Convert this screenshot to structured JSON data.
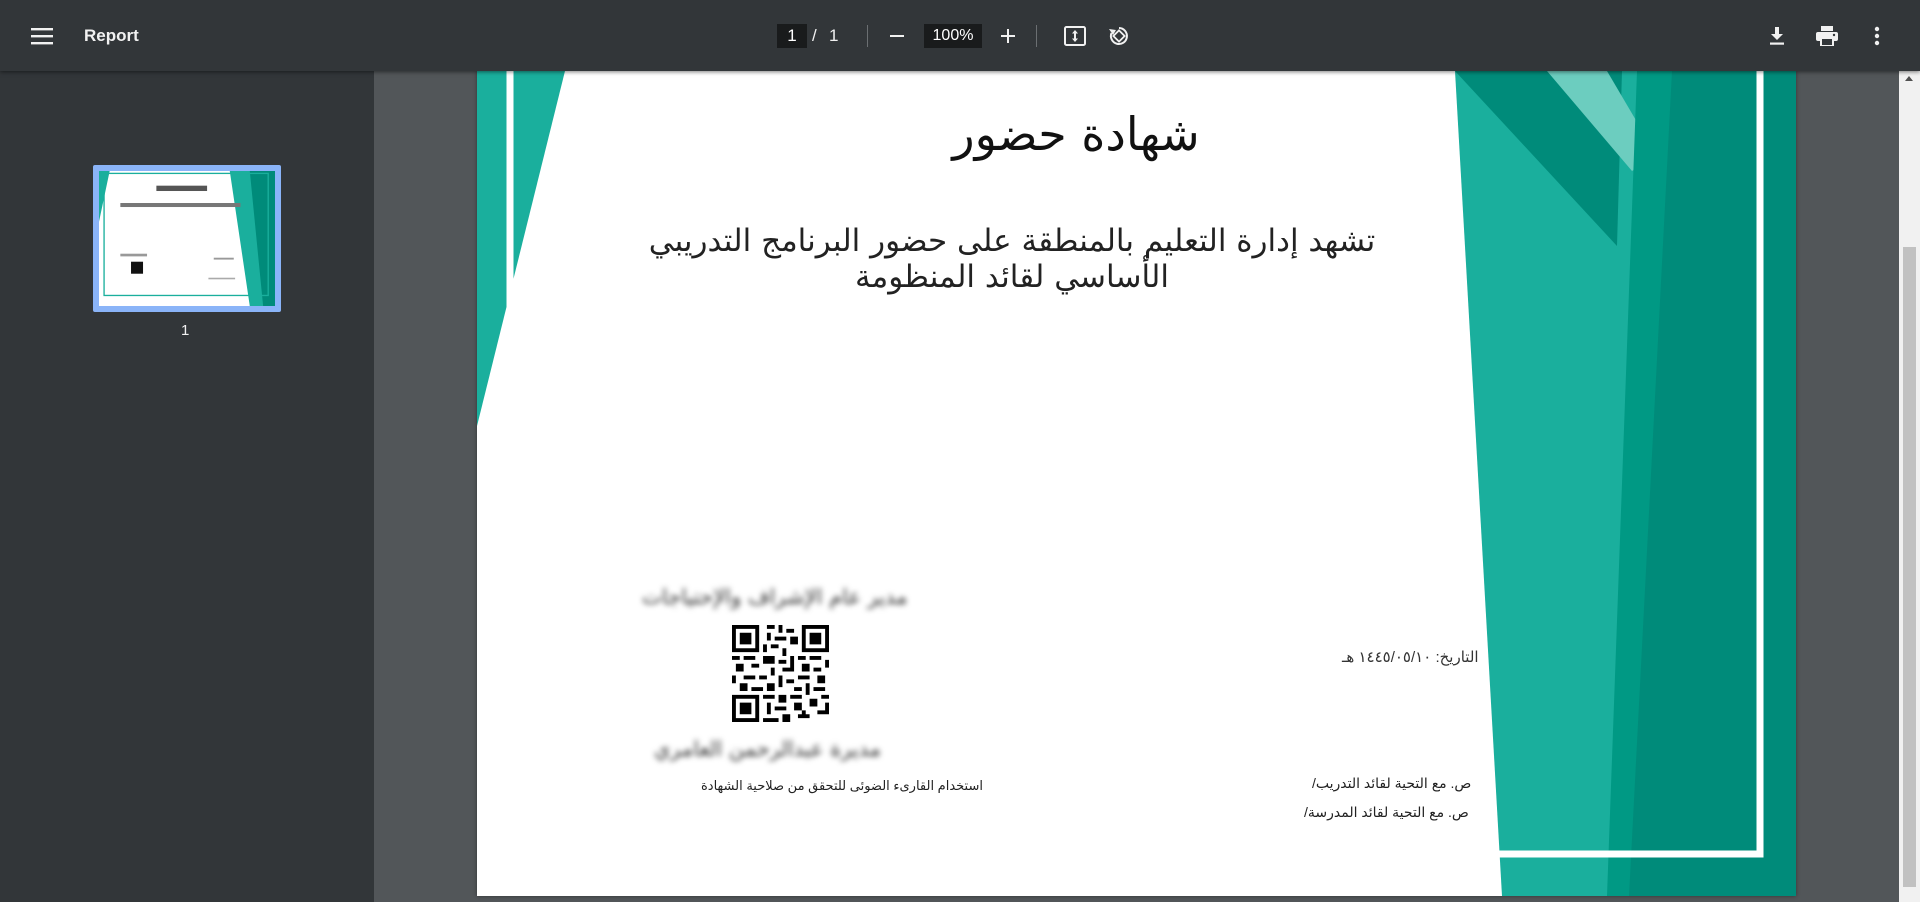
{
  "toolbar": {
    "title": "Report",
    "current_page": "1",
    "page_separator": "/",
    "total_pages": "1",
    "zoom": "100%",
    "icons": [
      "menu-icon",
      "zoom-out-icon",
      "zoom-in-icon",
      "fit-page-icon",
      "rotate-icon",
      "download-icon",
      "print-icon",
      "more-vert-icon"
    ]
  },
  "sidebar": {
    "thumbnails": [
      {
        "label": "1"
      }
    ]
  },
  "certificate": {
    "title": "شهادة حضور",
    "body": "تشهد إدارة التعليم بالمنطقة على حضور البرنامج التدريبي الأساسي لقائد المنظومة",
    "manager_label": "مدير عام الإشراف والإحتياجات",
    "manager_name": "مديرة عبدالرحمن العامري",
    "qr_caption": "استخدام القارىء الضوئى للتحقق من صلاحية الشهادة",
    "signature_date": "التاريخ: ١٤٤٥/٠٥/١٠ هـ",
    "cc_line_1": "ص. مع التحية لقائد التدريب/",
    "cc_line_2": "ص. مع التحية لقائد المدرسة/"
  },
  "colors": {
    "toolbar_bg": "#323639",
    "viewer_bg": "#525659",
    "accent_teal": "#1aaf9d",
    "accent_dark_teal": "#008b7a",
    "thumb_highlight": "#8ab4f8"
  }
}
